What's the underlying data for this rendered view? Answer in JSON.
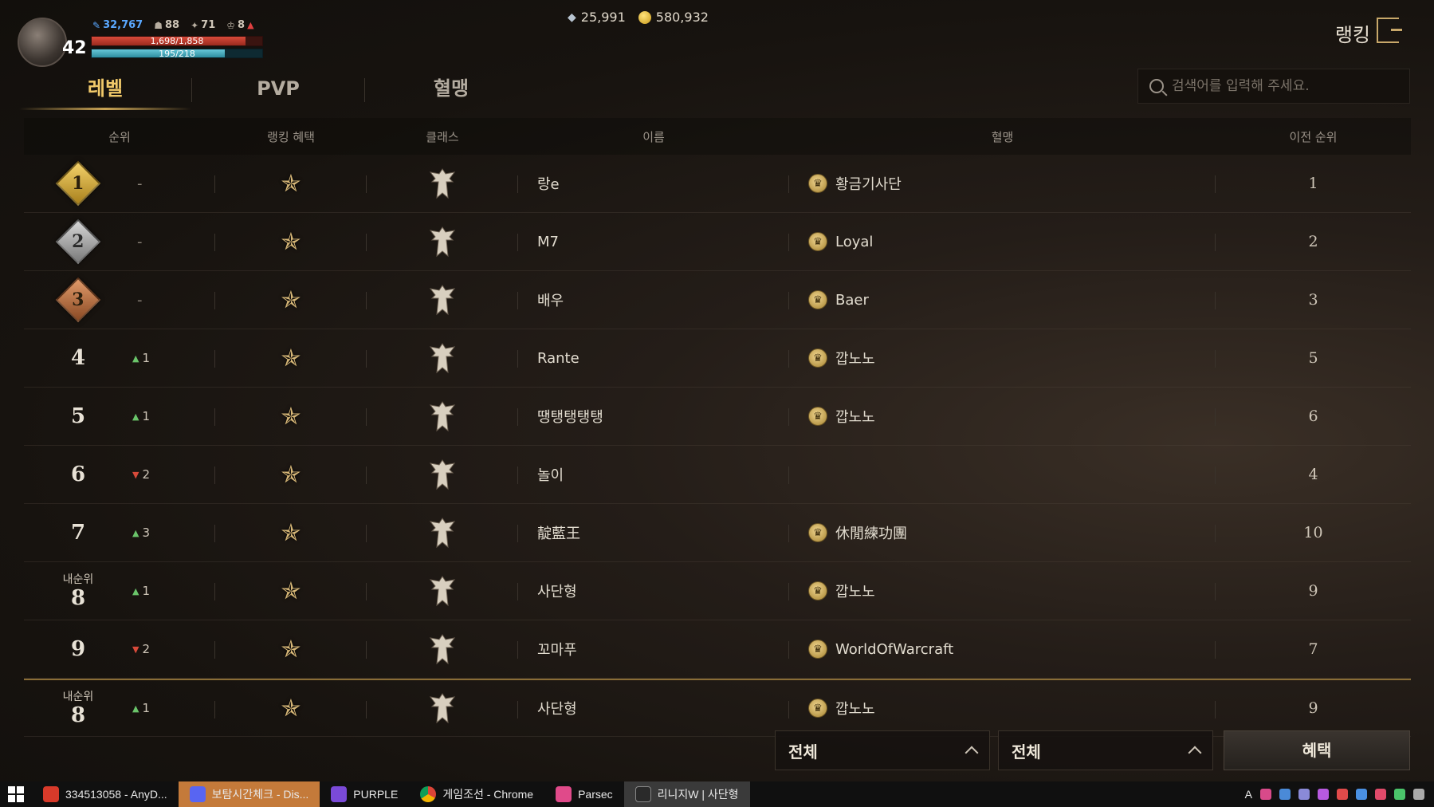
{
  "hud": {
    "level": "42",
    "power": "32,767",
    "stat_a": "88",
    "stat_b": "71",
    "stat_c": "8",
    "hp": "1,698/1,858",
    "mp": "195/218",
    "gems": "25,991",
    "gold": "580,932"
  },
  "page_title": "랭킹",
  "tabs": [
    "레벨",
    "PVP",
    "혈맹"
  ],
  "search": {
    "placeholder": "검색어를 입력해 주세요."
  },
  "columns": [
    "순위",
    "랭킹 혜택",
    "클래스",
    "이름",
    "혈맹",
    "이전 순위"
  ],
  "rows": [
    {
      "rank": "1",
      "badge": "gold",
      "change_dir": "none",
      "change": "-",
      "name": "랑e",
      "clan": "황금기사단",
      "prev": "1"
    },
    {
      "rank": "2",
      "badge": "silver",
      "change_dir": "none",
      "change": "-",
      "name": "M7",
      "clan": "Loyal",
      "prev": "2"
    },
    {
      "rank": "3",
      "badge": "bronze",
      "change_dir": "none",
      "change": "-",
      "name": "배우",
      "clan": "Baer",
      "prev": "3"
    },
    {
      "rank": "4",
      "badge": "",
      "change_dir": "up",
      "change": "1",
      "name": "Rante",
      "clan": "깝노노",
      "prev": "5"
    },
    {
      "rank": "5",
      "badge": "",
      "change_dir": "up",
      "change": "1",
      "name": "땡탱탱탱탱",
      "clan": "깝노노",
      "prev": "6"
    },
    {
      "rank": "6",
      "badge": "",
      "change_dir": "down",
      "change": "2",
      "name": "놀이",
      "clan": "",
      "prev": "4"
    },
    {
      "rank": "7",
      "badge": "",
      "change_dir": "up",
      "change": "3",
      "name": "靛藍王",
      "clan": "休閒練功團",
      "prev": "10"
    },
    {
      "rank": "8",
      "badge": "",
      "my_label": "내순위",
      "change_dir": "up",
      "change": "1",
      "name": "사단형",
      "clan": "깝노노",
      "prev": "9"
    },
    {
      "rank": "9",
      "badge": "",
      "change_dir": "down",
      "change": "2",
      "name": "꼬마푸",
      "clan": "WorldOfWarcraft",
      "prev": "7"
    }
  ],
  "my_row": {
    "rank": "8",
    "my_label": "내순위",
    "change_dir": "up",
    "change": "1",
    "name": "사단형",
    "clan": "깝노노",
    "prev": "9"
  },
  "filters": {
    "filter1": "전체",
    "filter2": "전체",
    "benefit_button": "혜택"
  },
  "taskbar": {
    "items": [
      "334513058 - AnyD...",
      "보탐시간체크 - Dis...",
      "PURPLE",
      "게임조선 - Chrome",
      "Parsec",
      "리니지W | 사단형"
    ],
    "lang": "A"
  },
  "colors": {
    "accent": "#f0c96a",
    "up": "#6ac46a",
    "down": "#d84a3a"
  }
}
